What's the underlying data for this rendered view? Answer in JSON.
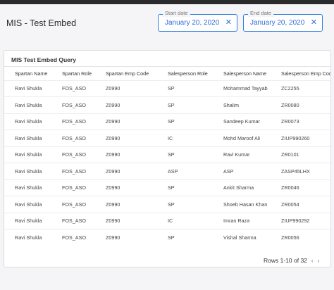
{
  "page": {
    "title": "MIS - Test Embed"
  },
  "filters": {
    "start": {
      "label": "Start date",
      "value": "January 20, 2020"
    },
    "end": {
      "label": "End date",
      "value": "January 20, 2020"
    },
    "clear_glyph": "✕"
  },
  "card": {
    "title": "MIS Test Embed Query",
    "columns": [
      "Spartan Name",
      "Spartan Role",
      "Spartan Emp Code",
      "Salesperson Role",
      "Salesperson Name",
      "Salesperson Emp Code"
    ],
    "rows": [
      [
        "Ravi Shukla",
        "FOS_ASO",
        "Z0990",
        "SP",
        "Mohammad Tayyab",
        "ZC2255"
      ],
      [
        "Ravi Shukla",
        "FOS_ASO",
        "Z0990",
        "SP",
        "Shalim",
        "ZR0080"
      ],
      [
        "Ravi Shukla",
        "FOS_ASO",
        "Z0990",
        "SP",
        "Sandeep Kumar",
        "ZR0073"
      ],
      [
        "Ravi Shukla",
        "FOS_ASO",
        "Z0990",
        "IC",
        "Mohd Maroof Ali",
        "ZIUP990260"
      ],
      [
        "Ravi Shukla",
        "FOS_ASO",
        "Z0990",
        "SP",
        "Ravi Kumar",
        "ZR0101"
      ],
      [
        "Ravi Shukla",
        "FOS_ASO",
        "Z0990",
        "ASP",
        "ASP",
        "ZASP45LHX"
      ],
      [
        "Ravi Shukla",
        "FOS_ASO",
        "Z0990",
        "SP",
        "Ankit Sharma",
        "ZR0046"
      ],
      [
        "Ravi Shukla",
        "FOS_ASO",
        "Z0990",
        "SP",
        "Shoeb Hasan Khan",
        "ZR0054"
      ],
      [
        "Ravi Shukla",
        "FOS_ASO",
        "Z0990",
        "IC",
        "Imran Raza",
        "ZIUP990292"
      ],
      [
        "Ravi Shukla",
        "FOS_ASO",
        "Z0990",
        "SP",
        "Vishal Sharma",
        "ZR0056"
      ]
    ]
  },
  "pagination": {
    "label": "Rows 1-10 of 32",
    "prev": "‹",
    "next": "›"
  },
  "colors": {
    "accent": "#2f80e0",
    "topbar": "#2b2b2e"
  }
}
